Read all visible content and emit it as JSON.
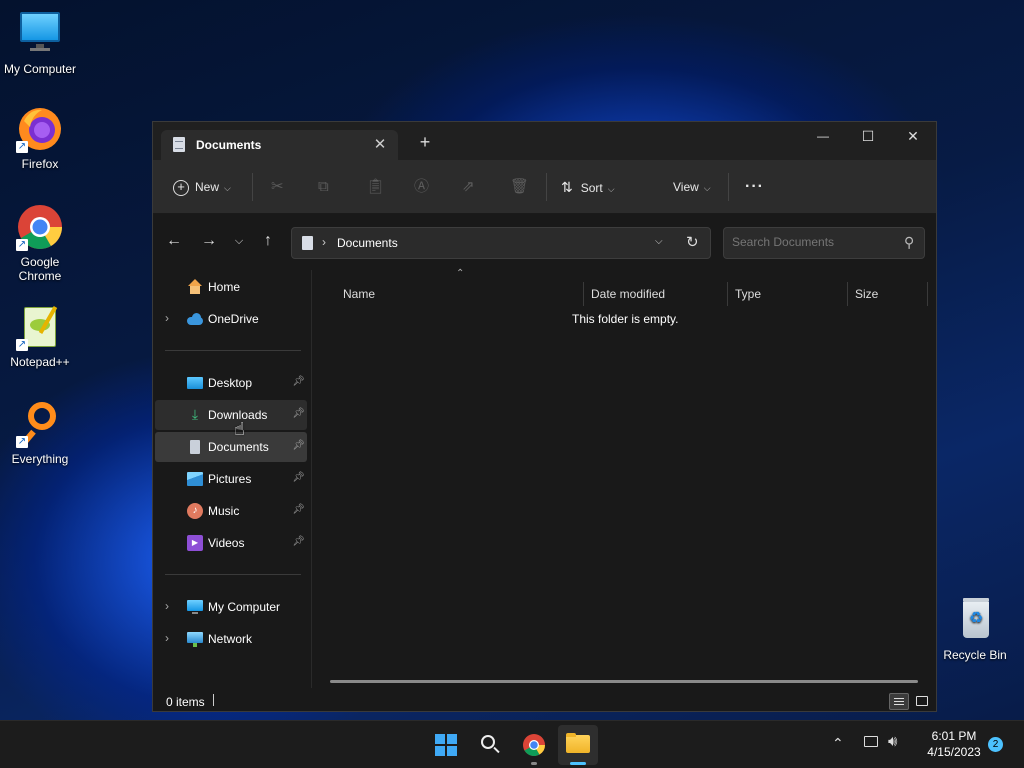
{
  "desktop": {
    "icons": [
      {
        "label": "My Computer"
      },
      {
        "label": "Firefox"
      },
      {
        "label": "Google Chrome"
      },
      {
        "label": "Notepad++"
      },
      {
        "label": "Everything"
      },
      {
        "label": "Recycle Bin"
      }
    ]
  },
  "window": {
    "tab_title": "Documents",
    "new_tab_glyph": "+",
    "controls": {
      "minimize": "—",
      "maximize": "☐",
      "close": "✕"
    }
  },
  "toolbar": {
    "new_label": "New",
    "sort_label": "Sort",
    "view_label": "View",
    "more_label": "···",
    "icons": [
      "cut-icon",
      "copy-icon",
      "paste-icon",
      "rename-icon",
      "share-icon",
      "delete-icon"
    ]
  },
  "address": {
    "path": "Documents",
    "search_placeholder": "Search Documents"
  },
  "nav": {
    "home": "Home",
    "onedrive": "OneDrive",
    "quick": [
      {
        "label": "Desktop"
      },
      {
        "label": "Downloads"
      },
      {
        "label": "Documents"
      },
      {
        "label": "Pictures"
      },
      {
        "label": "Music"
      },
      {
        "label": "Videos"
      }
    ],
    "mycomputer": "My Computer",
    "network": "Network"
  },
  "columns": {
    "name": "Name",
    "date": "Date modified",
    "type": "Type",
    "size": "Size"
  },
  "content": {
    "empty_message": "This folder is empty."
  },
  "status": {
    "items": "0 items"
  },
  "taskbar": {
    "time": "6:01 PM",
    "date": "4/15/2023",
    "notification_count": "2"
  },
  "colors": {
    "accent": "#0078d4",
    "selected_nav": "#3a3a3a",
    "hover_nav": "#2d2d2d"
  }
}
